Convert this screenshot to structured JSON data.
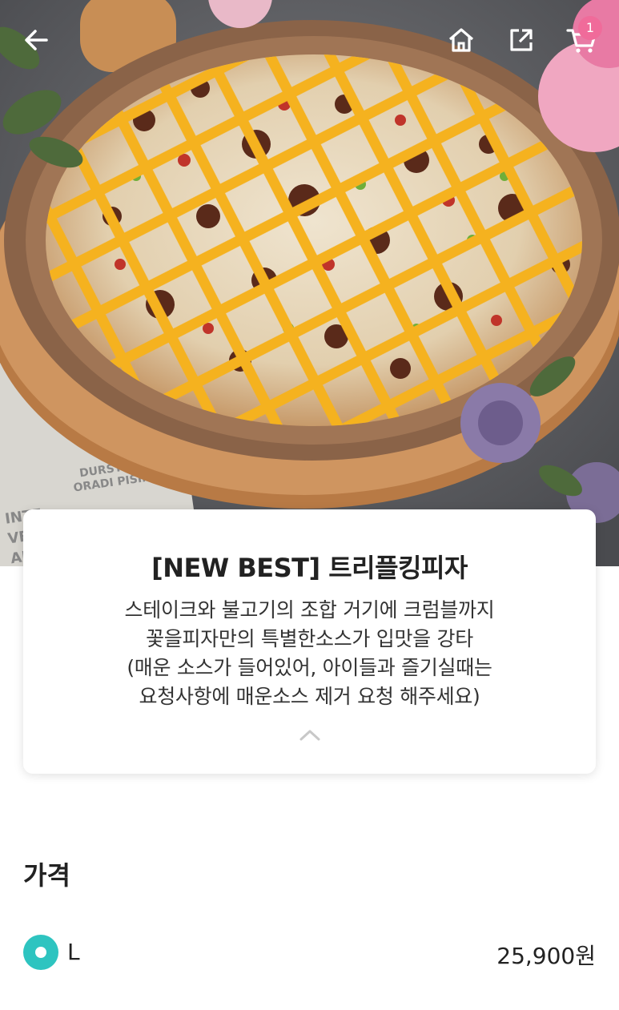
{
  "header": {
    "back_icon": "arrow-left-icon",
    "home_icon": "home-icon",
    "share_icon": "share-icon",
    "cart_icon": "cart-icon",
    "cart_count": "1",
    "accent": "#f06b9a"
  },
  "hero": {
    "image": "pizza-photo",
    "newspaper_text": [
      "DURST",
      "ORADI PISING",
      "INTE",
      "VE",
      "AM"
    ]
  },
  "product": {
    "title": "[NEW BEST] 트리플킹피자",
    "description": [
      "스테이크와 불고기의 조합 거기에 크럼블까지",
      "꽃을피자만의 특별한소스가 입맛을 강타",
      "(매운 소스가 들어있어, 아이들과 즐기실때는",
      "요청사항에 매운소스 제거 요청 해주세요)"
    ],
    "collapse_icon": "chevron-up-icon"
  },
  "price": {
    "heading": "가격",
    "options": [
      {
        "label": "L",
        "price": "25,900원",
        "selected": true
      }
    ],
    "radio_color": "#2ec4c0"
  }
}
